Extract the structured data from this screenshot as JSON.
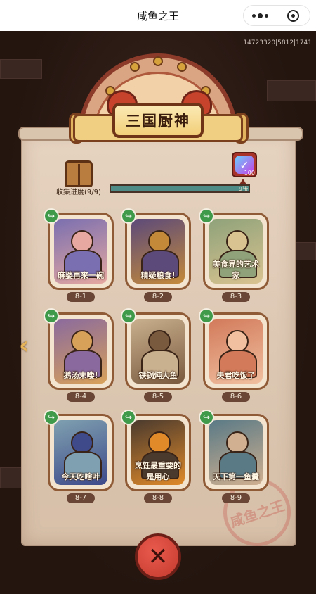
{
  "window": {
    "title": "咸鱼之王"
  },
  "debug_text": "14723320|5812|1741",
  "header": {
    "title": "三国厨神"
  },
  "progress": {
    "label": "收集进度(9/9)",
    "goal_label": "9张",
    "fraction": 1.0
  },
  "reward": {
    "count": "100",
    "icon": "gem-check-icon"
  },
  "cards": [
    {
      "caption": "麻婆再来一碗",
      "number": "8-1"
    },
    {
      "caption": "精疑粮食!",
      "number": "8-2"
    },
    {
      "caption": "美食界的艺术家",
      "number": "8-3"
    },
    {
      "caption": "鹅汤末喽!",
      "number": "8-4"
    },
    {
      "caption": "铁锅炖大鱼",
      "number": "8-5"
    },
    {
      "caption": "夫君吃饭了",
      "number": "8-6"
    },
    {
      "caption": "今天吃啥叶",
      "number": "8-7"
    },
    {
      "caption": "烹饪最重要的是用心",
      "number": "8-8"
    },
    {
      "caption": "天下第一鱼羹",
      "number": "8-9"
    }
  ],
  "stamp_text": "咸鱼之王",
  "colors": {
    "accent": "#c53a2f",
    "share": "#3f9a49",
    "progress": "#4e8b87"
  }
}
